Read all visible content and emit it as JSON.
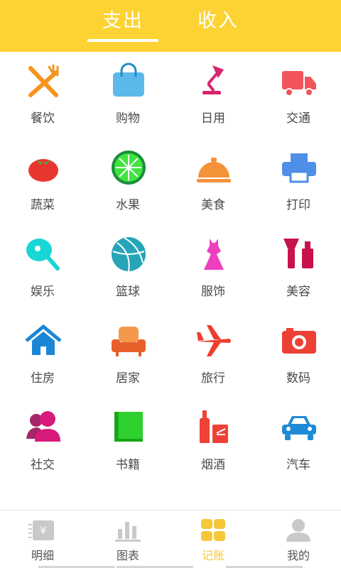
{
  "header": {
    "tabs": [
      {
        "label": "支出",
        "active": true
      },
      {
        "label": "收入",
        "active": false
      }
    ]
  },
  "categories": [
    {
      "label": "餐饮",
      "icon": "fork-knife-icon"
    },
    {
      "label": "购物",
      "icon": "shopping-bag-icon"
    },
    {
      "label": "日用",
      "icon": "desk-lamp-icon"
    },
    {
      "label": "交通",
      "icon": "truck-icon"
    },
    {
      "label": "蔬菜",
      "icon": "tomato-icon"
    },
    {
      "label": "水果",
      "icon": "lime-icon"
    },
    {
      "label": "美食",
      "icon": "food-cloche-icon"
    },
    {
      "label": "打印",
      "icon": "printer-icon"
    },
    {
      "label": "娱乐",
      "icon": "ping-pong-icon"
    },
    {
      "label": "篮球",
      "icon": "basketball-icon"
    },
    {
      "label": "服饰",
      "icon": "dress-icon"
    },
    {
      "label": "美容",
      "icon": "makeup-icon"
    },
    {
      "label": "住房",
      "icon": "house-icon"
    },
    {
      "label": "居家",
      "icon": "sofa-icon"
    },
    {
      "label": "旅行",
      "icon": "airplane-icon"
    },
    {
      "label": "数码",
      "icon": "camera-icon"
    },
    {
      "label": "社交",
      "icon": "people-icon"
    },
    {
      "label": "书籍",
      "icon": "book-icon"
    },
    {
      "label": "烟酒",
      "icon": "bottle-cigarette-icon"
    },
    {
      "label": "汽车",
      "icon": "car-icon"
    }
  ],
  "bottom_nav": [
    {
      "label": "明细",
      "icon": "receipt-icon",
      "active": false
    },
    {
      "label": "图表",
      "icon": "bar-chart-icon",
      "active": false
    },
    {
      "label": "记账",
      "icon": "grid-icon",
      "active": true
    },
    {
      "label": "我的",
      "icon": "user-icon",
      "active": false
    }
  ],
  "colors": {
    "header_bg": "#fdd334",
    "active_nav": "#f5c839",
    "label": "#4a4a4a"
  }
}
